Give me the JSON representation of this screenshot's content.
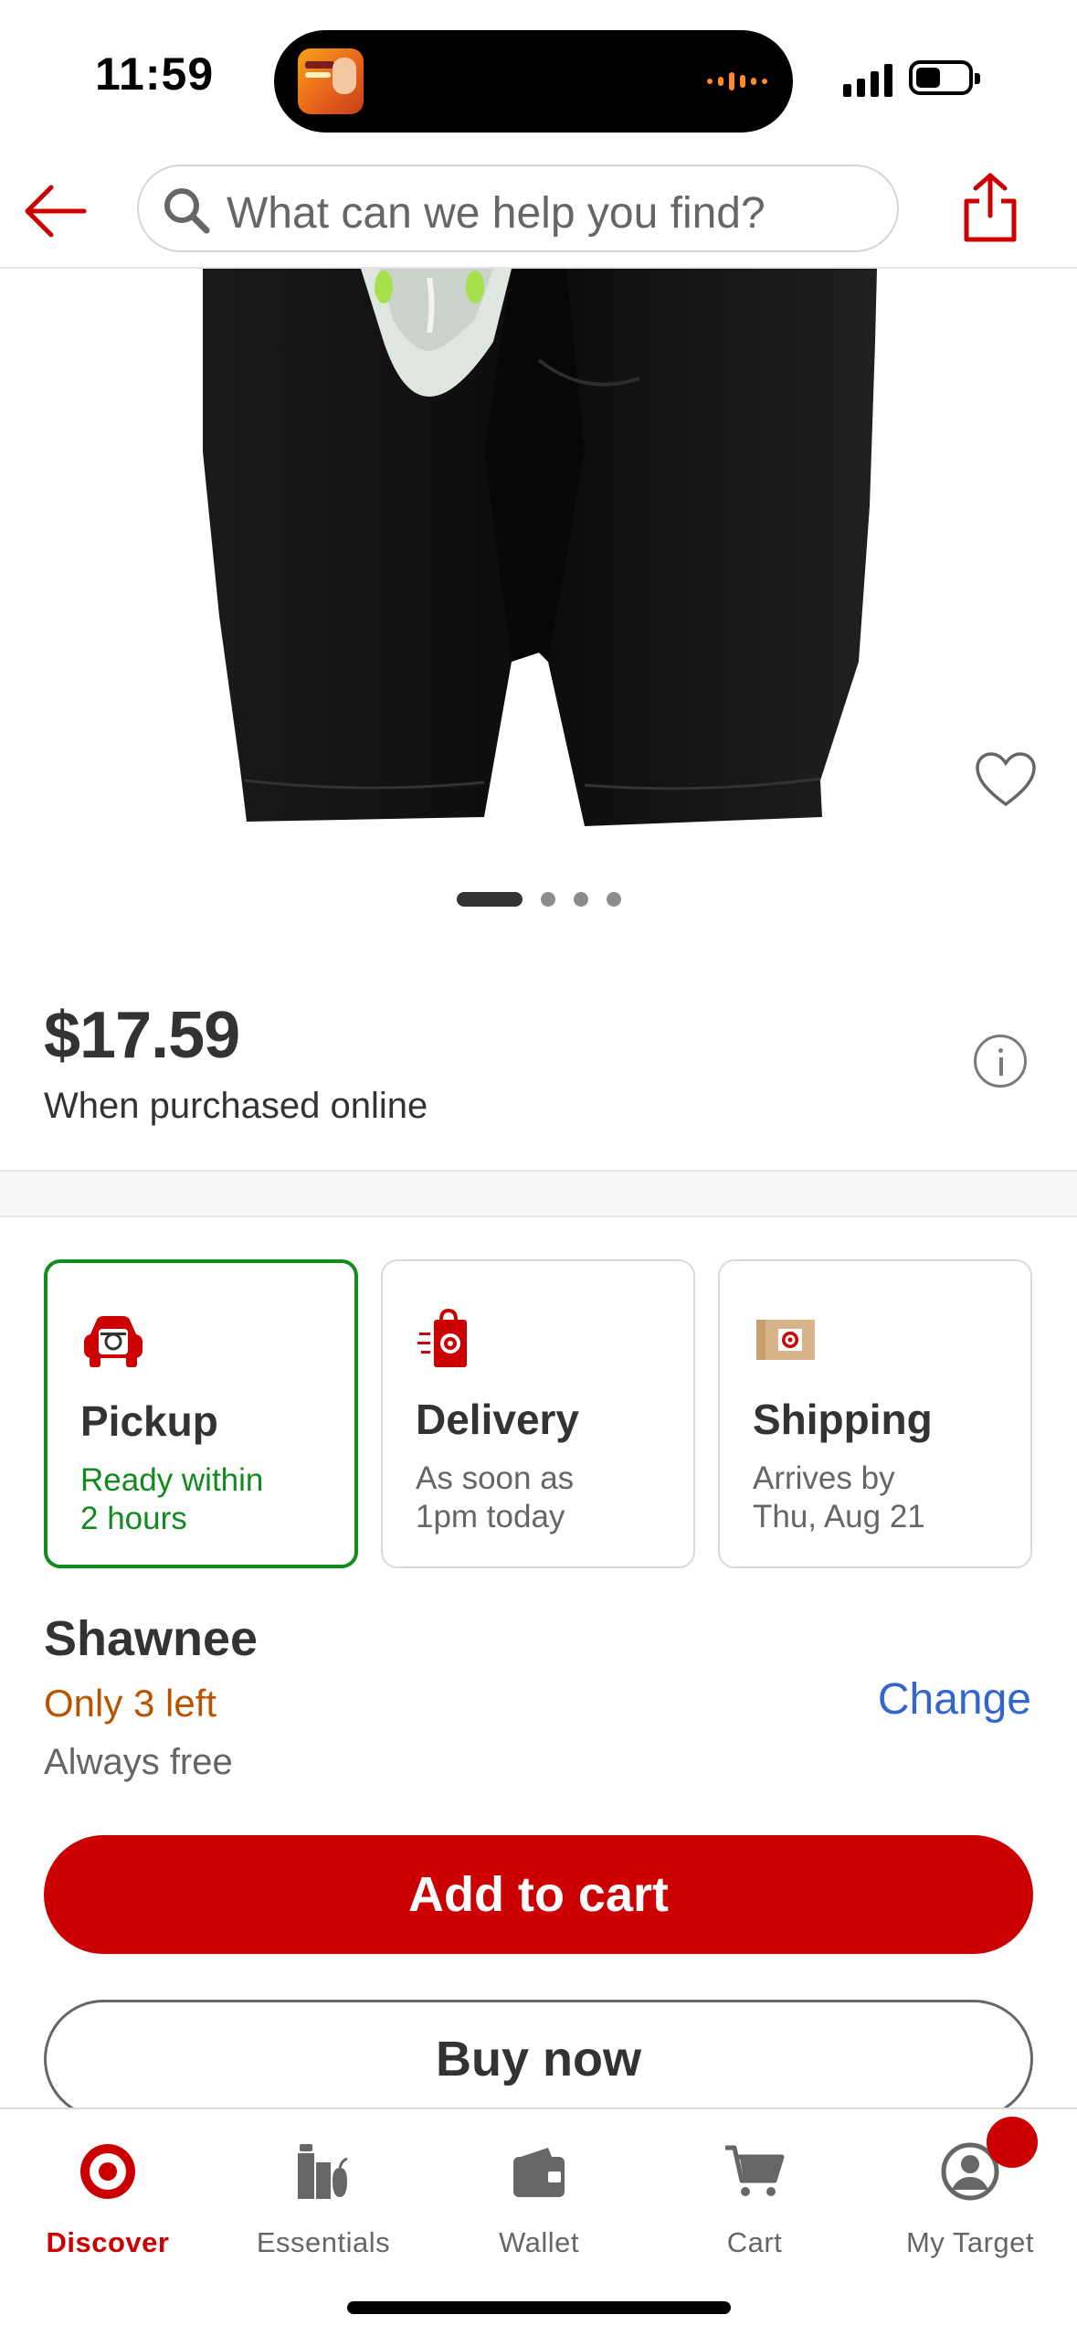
{
  "status_bar": {
    "time": "11:59"
  },
  "header": {
    "search_placeholder": "What can we help you find?",
    "back_icon": "arrow-left-icon",
    "share_icon": "share-icon"
  },
  "carousel": {
    "total_images": 4,
    "active_index": 0
  },
  "pricing": {
    "price": "$17.59",
    "subtext": "When purchased online"
  },
  "fulfillment": {
    "options": [
      {
        "title": "Pickup",
        "line1": "Ready within",
        "line2": "2 hours",
        "icon": "pickup-car-icon",
        "selected": true
      },
      {
        "title": "Delivery",
        "line1": "As soon as",
        "line2": "1pm today",
        "icon": "delivery-bag-icon",
        "selected": false
      },
      {
        "title": "Shipping",
        "line1": "Arrives by",
        "line2": "Thu, Aug 21",
        "icon": "shipping-box-icon",
        "selected": false
      }
    ]
  },
  "store": {
    "name": "Shawnee",
    "stock": "Only 3 left",
    "note": "Always free",
    "change_label": "Change"
  },
  "actions": {
    "add_to_cart": "Add to cart",
    "buy_now": "Buy now"
  },
  "tab_bar": {
    "items": [
      {
        "label": "Discover",
        "icon": "target-bullseye-icon",
        "active": true
      },
      {
        "label": "Essentials",
        "icon": "essentials-icon",
        "active": false
      },
      {
        "label": "Wallet",
        "icon": "wallet-icon",
        "active": false
      },
      {
        "label": "Cart",
        "icon": "cart-icon",
        "active": false
      },
      {
        "label": "My Target",
        "icon": "profile-icon",
        "active": false
      }
    ]
  },
  "colors": {
    "brand_red": "#cc0000",
    "pickup_green": "#118a1e",
    "stock_orange": "#b85300",
    "link_blue": "#3366cc"
  }
}
